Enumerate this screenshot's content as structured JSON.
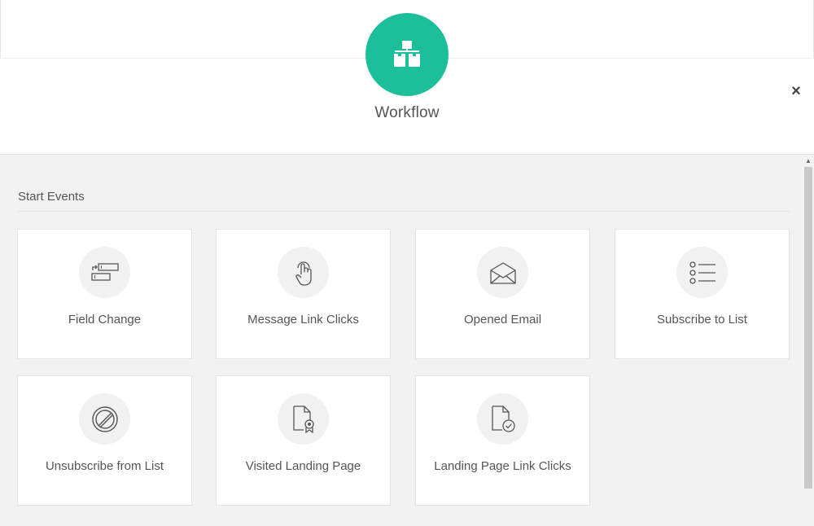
{
  "header": {
    "title": "Workflow",
    "logo_icon": "workflow-boxes-icon",
    "logo_color": "#1dbf9b",
    "close_label": "×"
  },
  "section": {
    "title": "Start Events"
  },
  "cards": [
    {
      "label": "Field Change",
      "icon": "field-change-icon"
    },
    {
      "label": "Message Link Clicks",
      "icon": "pointer-click-icon"
    },
    {
      "label": "Opened Email",
      "icon": "open-envelope-icon"
    },
    {
      "label": "Subscribe to List",
      "icon": "list-icon"
    },
    {
      "label": "Unsubscribe from List",
      "icon": "unsubscribe-icon"
    },
    {
      "label": "Visited Landing Page",
      "icon": "landing-page-badge-icon"
    },
    {
      "label": "Landing Page Link Clicks",
      "icon": "landing-page-check-icon"
    }
  ],
  "scrollbar": {
    "up_arrow": "▲"
  }
}
